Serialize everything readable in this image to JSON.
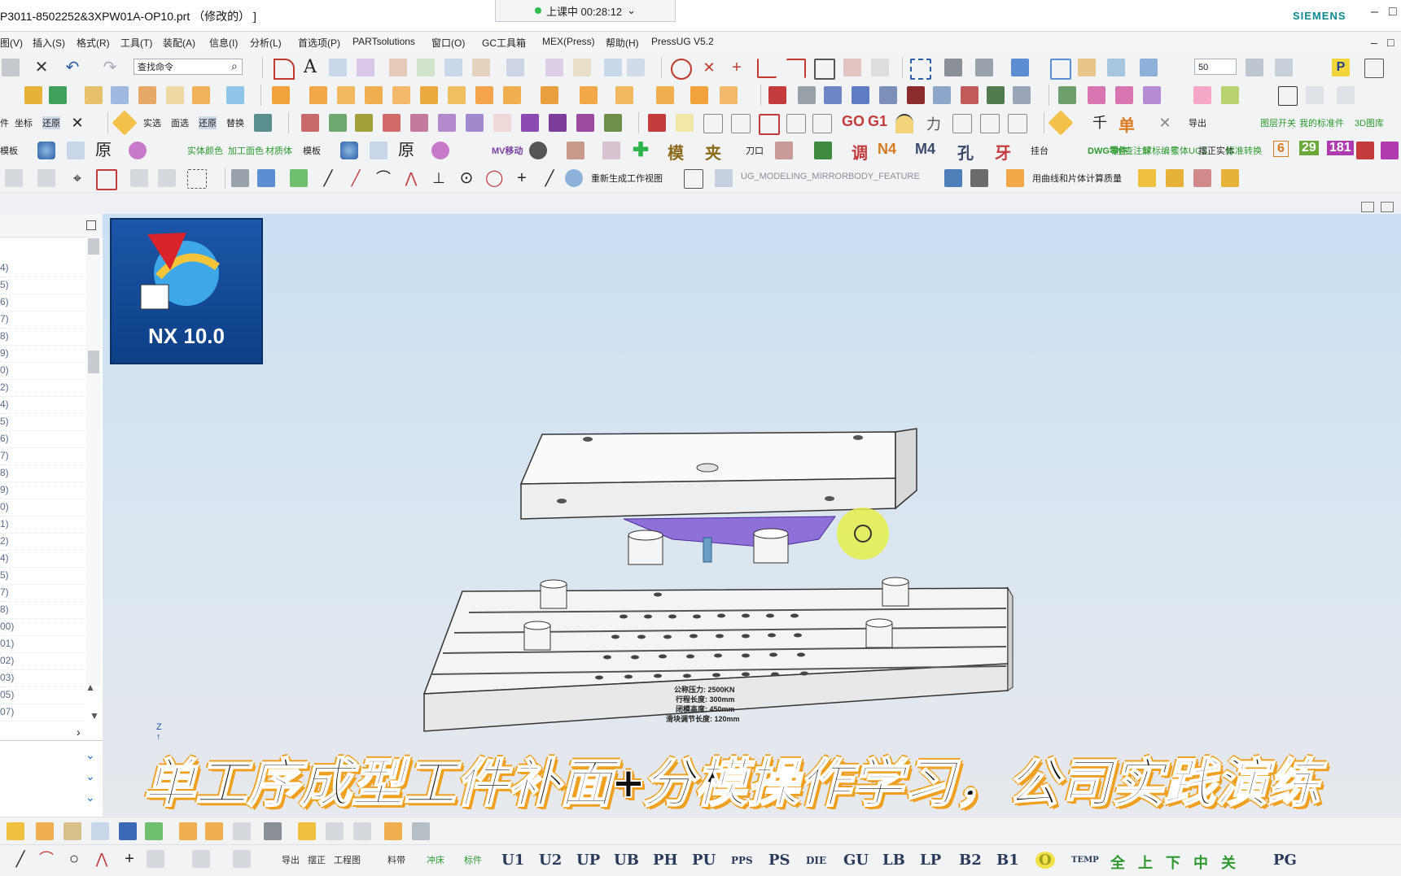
{
  "window": {
    "title": "P3011-8502252&3XPW01A-OP10.prt （修改的） ]",
    "timer": "上课中 00:28:12",
    "brand": "SIEMENS"
  },
  "menu": [
    "图(V)",
    "插入(S)",
    "格式(R)",
    "工具(T)",
    "装配(A)",
    "信息(I)",
    "分析(L)",
    "首选项(P)",
    "PARTsolutions",
    "窗口(O)",
    "GC工具箱",
    "MEX(Press)",
    "帮助(H)",
    "PressUG V5.2"
  ],
  "toolbar": {
    "search_placeholder": "查找命令",
    "zoom_value": "50",
    "row3_labels": [
      "件",
      "坐标",
      "还原",
      "实选",
      "面选",
      "还原",
      "替换",
      "GO",
      "G1",
      "力",
      "单",
      "导出",
      "图层开关",
      "我的标准件",
      "3D图库"
    ],
    "row4_labels": [
      "模板",
      "实体颜色",
      "加工面色",
      "材质体",
      "模板",
      "MV移动",
      "模",
      "夹",
      "刀口",
      "调",
      "N4",
      "M4",
      "孔",
      "牙",
      "挂台",
      "DWG零件",
      "检查注解",
      "球标编号",
      "实体UCS",
      "摆正实体",
      "标准转换",
      "6",
      "29",
      "181"
    ],
    "row5_labels": [
      "重新生成工作视图",
      "UG_MODELING_MIRRORBODY_FEATURE",
      "用曲线和片体计算质量"
    ]
  },
  "navigator": {
    "rows": [
      "4)",
      "5)",
      "6)",
      "7)",
      "8)",
      "9)",
      "0)",
      "2)",
      "4)",
      "5)",
      "6)",
      "7)",
      "8)",
      "9)",
      "0)",
      "1)",
      "2)",
      "4)",
      "5)",
      "7)",
      "8)",
      "00)",
      "01)",
      "02)",
      "03)",
      "05)",
      "07)"
    ]
  },
  "desktop_icon": {
    "label": "NX 10.0"
  },
  "model": {
    "nameplate": [
      "公称压力: 2500KN",
      "行程长度: 300mm",
      "闭模高度: 450mm",
      "滑块调节长度: 120mm"
    ]
  },
  "caption": "单工序成型工件补面+分模操作学习，公司实践演练",
  "bottom_toolbar": {
    "small": [
      "导出",
      "摆正",
      "工程图",
      "料带",
      "冲床",
      "标件"
    ],
    "big": [
      "U1",
      "U2",
      "UP",
      "UB",
      "PH",
      "PU",
      "PPS",
      "PS",
      "DIE",
      "GU",
      "LB",
      "LP",
      "B2",
      "B1",
      "O",
      "TEMP",
      "全",
      "上",
      "下",
      "中",
      "关",
      "PG"
    ]
  },
  "colors": {
    "accent": "#0d8a8f",
    "viewport_top": "#c9dff3",
    "caption_outline": "#f0a020"
  }
}
